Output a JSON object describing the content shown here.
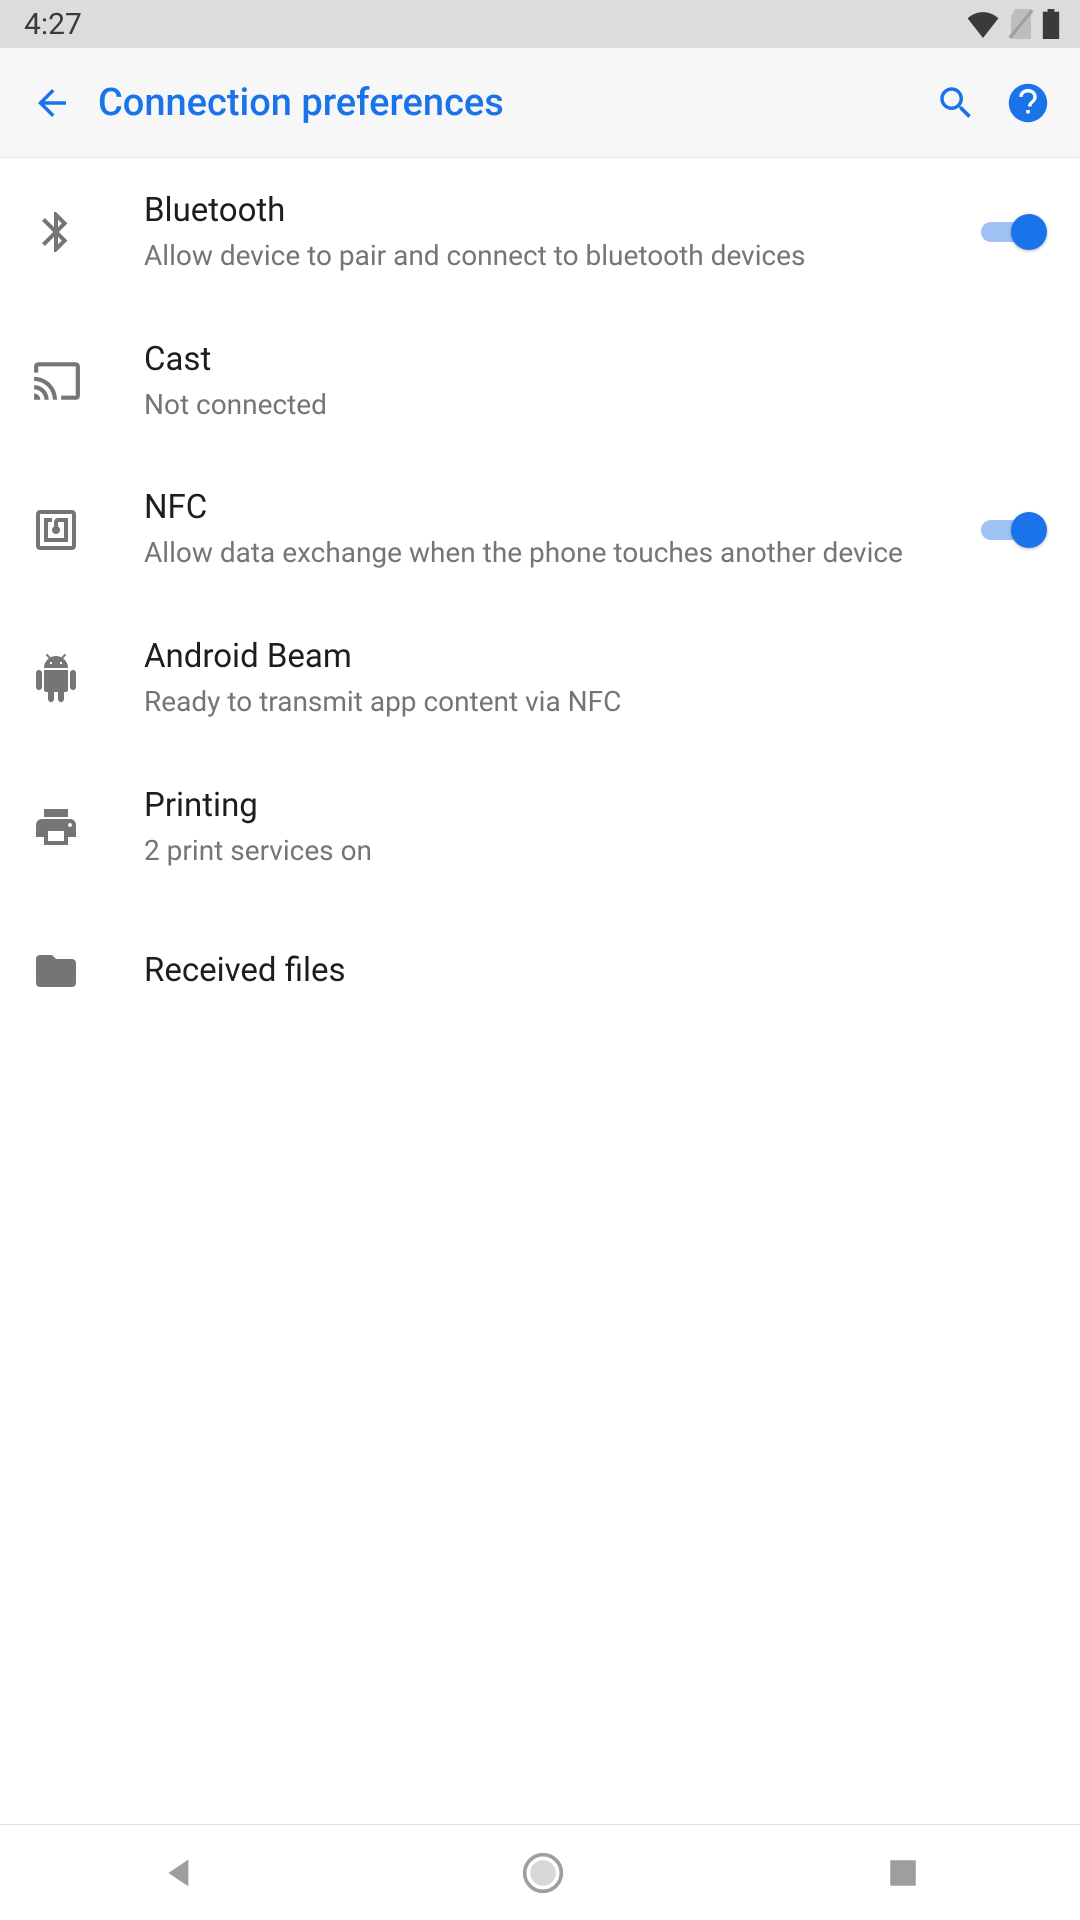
{
  "status": {
    "time": "4:27"
  },
  "header": {
    "title": "Connection preferences"
  },
  "items": [
    {
      "icon": "bluetooth",
      "title": "Bluetooth",
      "sub": "Allow device to pair and connect to bluetooth devices",
      "toggle": true,
      "on": true
    },
    {
      "icon": "cast",
      "title": "Cast",
      "sub": "Not connected"
    },
    {
      "icon": "nfc",
      "title": "NFC",
      "sub": "Allow data exchange when the phone touches another device",
      "toggle": true,
      "on": true
    },
    {
      "icon": "android",
      "title": "Android Beam",
      "sub": "Ready to transmit app content via NFC"
    },
    {
      "icon": "print",
      "title": "Printing",
      "sub": "2 print services on"
    },
    {
      "icon": "folder",
      "title": "Received files"
    }
  ]
}
